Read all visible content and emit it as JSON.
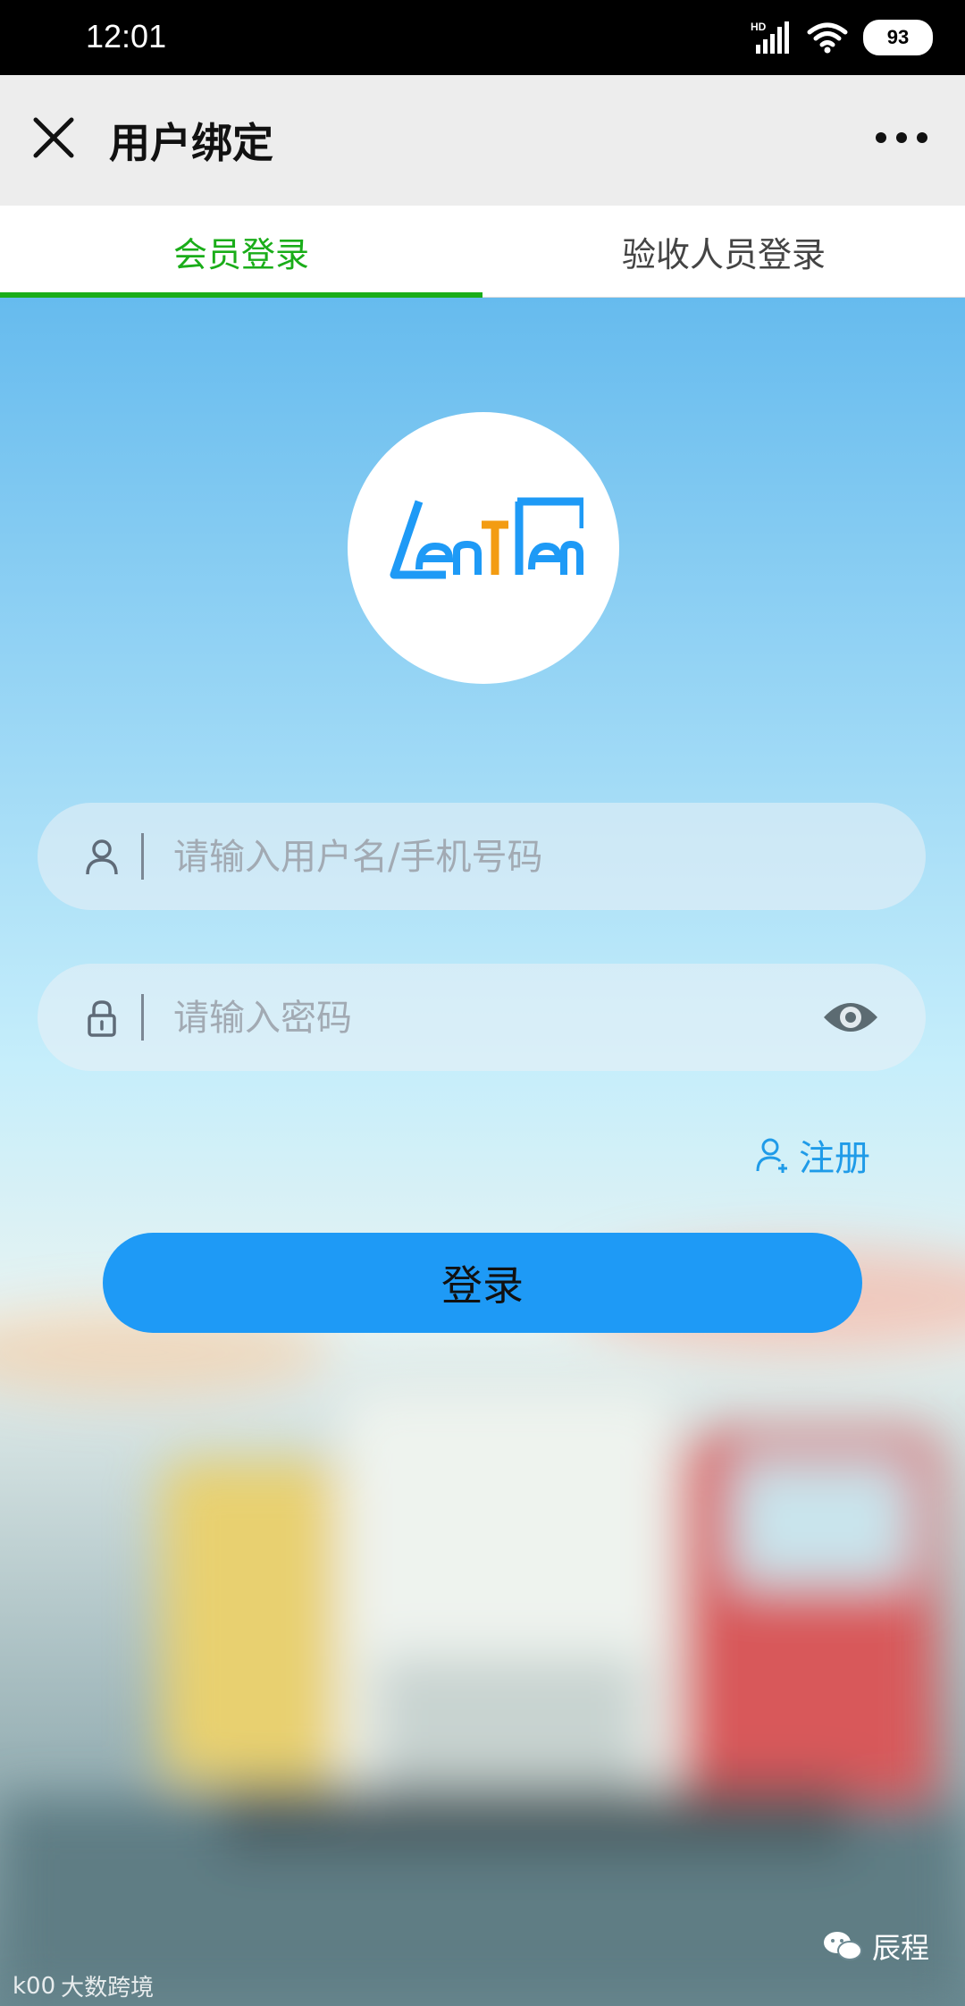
{
  "status_bar": {
    "time": "12:01",
    "battery": "93",
    "icons": [
      "hd-signal-icon",
      "wifi-icon",
      "battery-icon"
    ]
  },
  "header": {
    "title": "用户绑定",
    "close_icon": "close-icon",
    "more_icon": "more-icon"
  },
  "tabs": [
    {
      "label": "会员登录",
      "active": true
    },
    {
      "label": "验收人员登录",
      "active": false
    }
  ],
  "logo": {
    "text": "LenTLen"
  },
  "form": {
    "username_placeholder": "请输入用户名/手机号码",
    "password_placeholder": "请输入密码",
    "register_label": "注册",
    "login_label": "登录"
  },
  "watermarks": {
    "left": "大数跨境",
    "left_logo": "k00",
    "right": "辰程"
  },
  "colors": {
    "tab_active": "#1aad19",
    "login_button": "#1e9af6",
    "register_link": "#1f9be8"
  }
}
